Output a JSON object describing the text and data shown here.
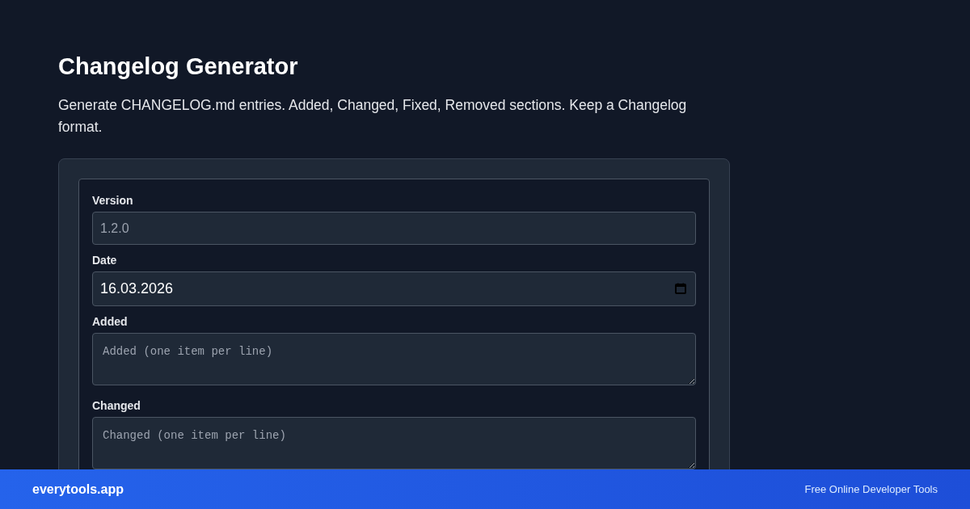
{
  "page": {
    "title": "Changelog Generator",
    "description": "Generate CHANGELOG.md entries. Added, Changed, Fixed, Removed sections. Keep a Changelog format."
  },
  "form": {
    "fields": [
      {
        "kind": "text",
        "label": "Version",
        "placeholder": "1.2.0"
      },
      {
        "kind": "date",
        "label": "Date",
        "value": "16.03.2026"
      },
      {
        "kind": "textarea",
        "label": "Added",
        "placeholder": "Added (one item per line)"
      },
      {
        "kind": "textarea",
        "label": "Changed",
        "placeholder": "Changed (one item per line)"
      }
    ]
  },
  "footer": {
    "brand": "everytools.app",
    "tagline": "Free Online Developer Tools"
  }
}
